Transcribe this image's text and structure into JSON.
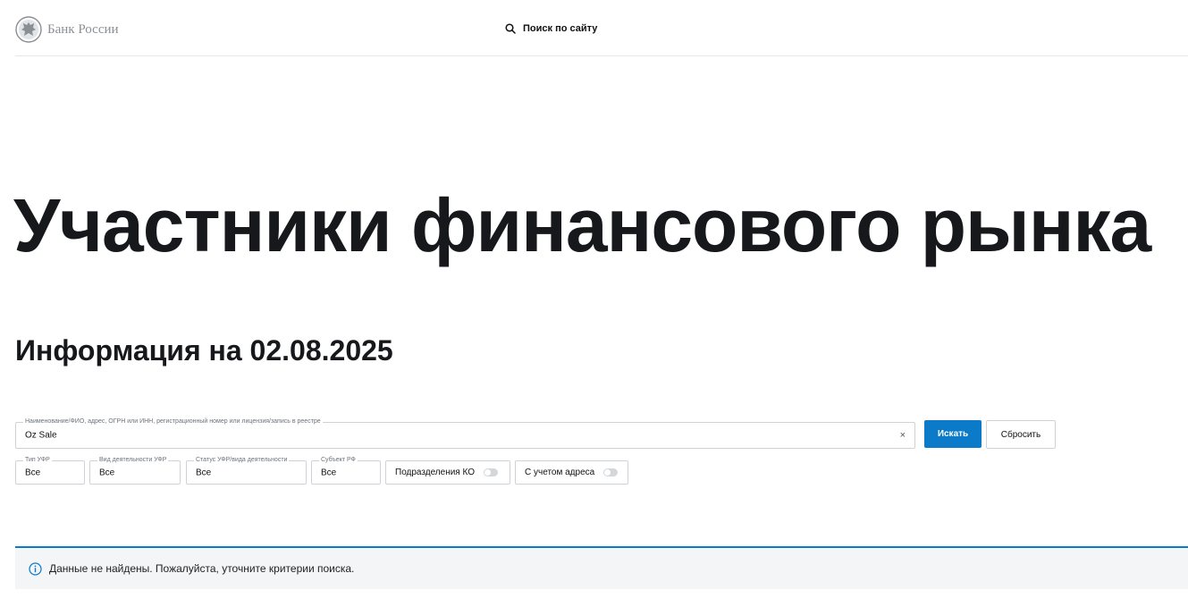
{
  "header": {
    "logo_text": "Банк России",
    "site_search_label": "Поиск по сайту"
  },
  "page": {
    "title": "Участники финансового рынка",
    "info_heading": "Информация на 02.08.2025"
  },
  "search": {
    "legend": "Наименование/ФИО, адрес, ОГРН или ИНН, регистрационный номер или лицензия/запись в реестре",
    "value": "Oz Sale",
    "clear_glyph": "×",
    "submit_label": "Искать",
    "reset_label": "Сбросить"
  },
  "filters": [
    {
      "legend": "Тип УФР",
      "value": "Все"
    },
    {
      "legend": "Вид деятельности УФР",
      "value": "Все"
    },
    {
      "legend": "Статус УФР/вида деятельности",
      "value": "Все"
    },
    {
      "legend": "Субъект РФ",
      "value": "Все"
    }
  ],
  "toggles": [
    {
      "label": "Подразделения КО",
      "on": false
    },
    {
      "label": "С учетом адреса",
      "on": false
    }
  ],
  "result": {
    "message": "Данные не найдены. Пожалуйста, уточните критерии поиска."
  },
  "colors": {
    "accent": "#0b7ac8",
    "alert_bg": "#f4f5f6",
    "logo_grey": "#8a8f96"
  }
}
